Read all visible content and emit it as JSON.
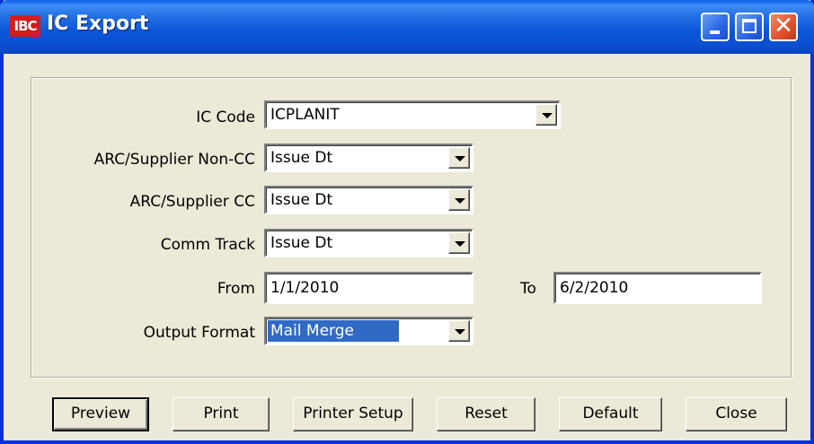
{
  "window": {
    "title": "IC Export",
    "icon_text": "IBC"
  },
  "form": {
    "ic_code": {
      "label": "IC Code",
      "value": "ICPLANIT"
    },
    "arc_non_cc": {
      "label": "ARC/Supplier Non-CC",
      "value": "Issue Dt"
    },
    "arc_cc": {
      "label": "ARC/Supplier CC",
      "value": "Issue Dt"
    },
    "comm_track": {
      "label": "Comm Track",
      "value": "Issue Dt"
    },
    "from": {
      "label": "From",
      "value": "1/1/2010"
    },
    "to": {
      "label": "To",
      "value": "6/2/2010"
    },
    "output_format": {
      "label": "Output Format",
      "value": "Mail Merge"
    }
  },
  "buttons": {
    "preview": "Preview",
    "print": "Print",
    "printer_setup": "Printer Setup",
    "reset": "Reset",
    "default": "Default",
    "close": "Close"
  },
  "colors": {
    "titlebar": "#0a55d8",
    "dialog_bg": "#ece9d8",
    "selection": "#316ac5",
    "close_button": "#e0502c"
  }
}
